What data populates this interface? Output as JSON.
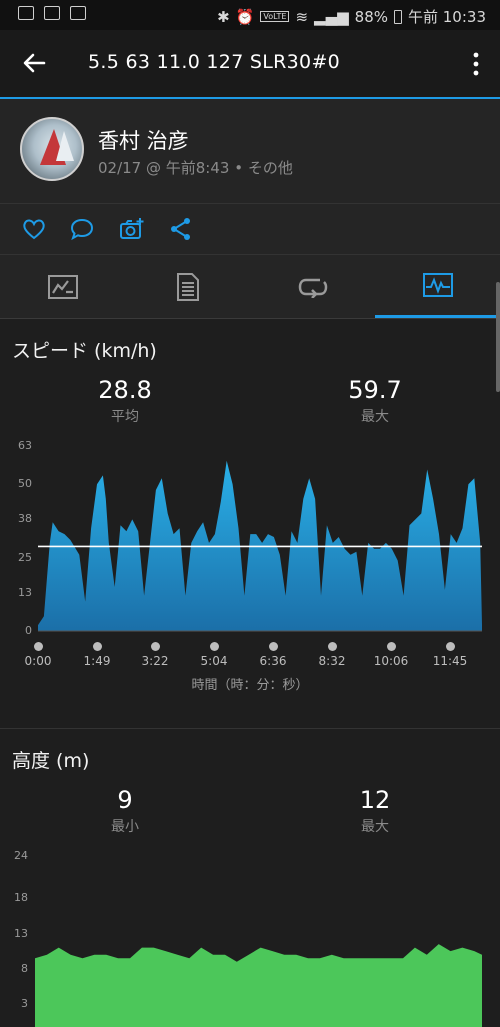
{
  "status_bar": {
    "battery": "88%",
    "time": "午前 10:33",
    "icons": [
      "gallery-icon",
      "image-icon",
      "check-icon",
      "bluetooth-icon",
      "alarm-icon",
      "volte-icon",
      "wifi-icon",
      "signal-icon",
      "battery-icon"
    ]
  },
  "app_bar": {
    "title": "5.5  63  11.0   127  SLR30#0"
  },
  "profile": {
    "name": "香村 治彦",
    "subtitle": "02/17 @ 午前8:43 • その他"
  },
  "actions": [
    "like-icon",
    "comment-icon",
    "add-photo-icon",
    "share-icon"
  ],
  "tabs": [
    {
      "icon": "summary-icon",
      "active": false
    },
    {
      "icon": "details-icon",
      "active": false
    },
    {
      "icon": "laps-icon",
      "active": false
    },
    {
      "icon": "charts-icon",
      "active": true
    }
  ],
  "colors": {
    "accent": "#1e9be6",
    "speed_fill_top": "#2ab0e8",
    "speed_fill_bottom": "#1b6fa8",
    "elev_fill": "#4cc75a"
  },
  "speed": {
    "title": "スピード (km/h)",
    "avg_value": "28.8",
    "avg_label": "平均",
    "max_value": "59.7",
    "max_label": "最大",
    "xlabel": "時間（時：分：秒）"
  },
  "elevation": {
    "title": "高度 (m)",
    "min_value": "9",
    "min_label": "最小",
    "max_value": "12",
    "max_label": "最大"
  },
  "chart_data": [
    {
      "type": "area",
      "title": "スピード (km/h)",
      "xlabel": "時間（時：分：秒）",
      "ylabel": "",
      "yticks": [
        "0",
        "13",
        "25",
        "38",
        "50",
        "63"
      ],
      "ylim": [
        0,
        63
      ],
      "xticks": [
        "0:00",
        "1:49",
        "3:22",
        "5:04",
        "6:36",
        "8:32",
        "10:06",
        "11:45"
      ],
      "xlim": [
        0,
        753
      ],
      "average_line": 28.8,
      "grid": false,
      "x": [
        0,
        10,
        20,
        25,
        35,
        45,
        55,
        70,
        80,
        90,
        100,
        110,
        115,
        120,
        130,
        140,
        150,
        160,
        170,
        180,
        190,
        200,
        210,
        220,
        230,
        240,
        250,
        260,
        270,
        280,
        290,
        300,
        310,
        320,
        330,
        340,
        350,
        360,
        370,
        380,
        390,
        400,
        410,
        420,
        430,
        440,
        450,
        460,
        470,
        480,
        490,
        500,
        510,
        520,
        530,
        540,
        550,
        560,
        570,
        580,
        590,
        600,
        610,
        620,
        630,
        640,
        650,
        660,
        670,
        680,
        690,
        700,
        710,
        720,
        730,
        740,
        750,
        753
      ],
      "values": [
        2,
        5,
        30,
        37,
        34,
        33,
        31,
        26,
        10,
        35,
        50,
        53,
        45,
        30,
        15,
        36,
        34,
        38,
        34,
        12,
        30,
        48,
        52,
        40,
        33,
        35,
        12,
        30,
        34,
        37,
        30,
        33,
        44,
        58,
        50,
        35,
        12,
        33,
        33,
        30,
        33,
        32,
        26,
        12,
        34,
        30,
        45,
        52,
        45,
        12,
        36,
        30,
        32,
        28,
        26,
        27,
        12,
        30,
        28,
        28,
        30,
        28,
        24,
        12,
        36,
        38,
        40,
        55,
        45,
        33,
        14,
        33,
        30,
        35,
        50,
        52,
        30,
        2
      ]
    },
    {
      "type": "area",
      "title": "高度 (m)",
      "yticks": [
        "3",
        "8",
        "13",
        "18",
        "24"
      ],
      "ylim": [
        0,
        24
      ],
      "grid": false,
      "x": [
        0,
        20,
        40,
        60,
        80,
        100,
        120,
        140,
        160,
        180,
        200,
        220,
        240,
        260,
        280,
        300,
        320,
        340,
        360,
        380,
        400,
        420,
        440,
        460,
        480,
        500,
        520,
        540,
        560,
        580,
        600,
        620,
        640,
        660,
        680,
        700,
        720,
        740,
        753
      ],
      "values": [
        9.5,
        10,
        11,
        10,
        9.5,
        10,
        10,
        9.5,
        9.5,
        11,
        11,
        10.5,
        10,
        9.5,
        11,
        10,
        10,
        9,
        10,
        11,
        10.5,
        10,
        10,
        9.5,
        9.5,
        10,
        9.5,
        9.5,
        9.5,
        9.5,
        9.5,
        9.5,
        11,
        10,
        11.5,
        10.5,
        11,
        10.5,
        10
      ]
    }
  ]
}
